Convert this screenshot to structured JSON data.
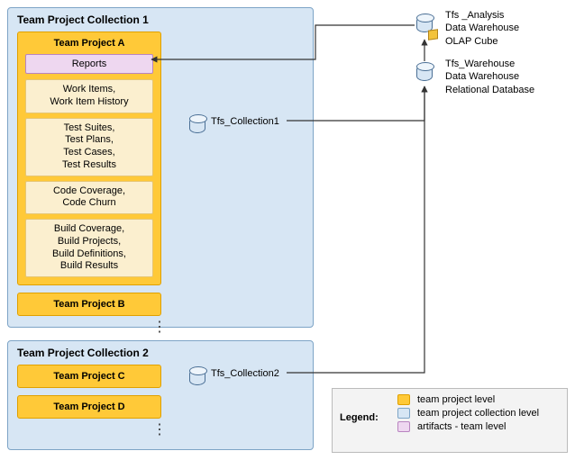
{
  "collections": [
    {
      "title": "Team Project Collection 1",
      "db_label": "Tfs_Collection1",
      "projects": [
        {
          "title": "Team Project A",
          "artifact": "Reports",
          "items": [
            "Work Items,\nWork Item History",
            "Test Suites,\nTest Plans,\nTest Cases,\nTest Results",
            "Code Coverage,\nCode Churn",
            "Build Coverage,\nBuild Projects,\nBuild Definitions,\nBuild Results"
          ]
        },
        {
          "title": "Team Project B"
        }
      ]
    },
    {
      "title": "Team Project Collection 2",
      "db_label": "Tfs_Collection2",
      "projects": [
        {
          "title": "Team Project C"
        },
        {
          "title": "Team Project D"
        }
      ]
    }
  ],
  "warehouse": {
    "analysis": {
      "name": "Tfs _Analysis",
      "line2": "Data Warehouse",
      "line3": "OLAP Cube"
    },
    "relational": {
      "name": "Tfs_Warehouse",
      "line2": "Data Warehouse",
      "line3": "Relational Database"
    }
  },
  "legend": {
    "title": "Legend:",
    "items": [
      {
        "swatch": "orange",
        "label": "team project level"
      },
      {
        "swatch": "blue",
        "label": "team project collection level"
      },
      {
        "swatch": "purple",
        "label": "artifacts - team level"
      }
    ]
  },
  "chart_data": {
    "type": "diagram",
    "description": "TFS data-warehouse architecture: multiple Team Project Collections each contain Team Projects; artifacts (Reports) inside a Team Project are fed by Tfs_Analysis OLAP cube; collection databases (Tfs_Collection1, Tfs_Collection2) feed Tfs_Warehouse relational data warehouse; Tfs_Warehouse feeds Tfs_Analysis.",
    "nodes": [
      {
        "id": "coll1",
        "label": "Team Project Collection 1",
        "level": "collection"
      },
      {
        "id": "projA",
        "label": "Team Project A",
        "level": "project",
        "parent": "coll1"
      },
      {
        "id": "reports",
        "label": "Reports",
        "level": "artifact",
        "parent": "projA"
      },
      {
        "id": "projA_items",
        "label": [
          "Work Items, Work Item History",
          "Test Suites, Test Plans, Test Cases, Test Results",
          "Code Coverage, Code Churn",
          "Build Coverage, Build Projects, Build Definitions, Build Results"
        ],
        "parent": "projA"
      },
      {
        "id": "projB",
        "label": "Team Project B",
        "level": "project",
        "parent": "coll1"
      },
      {
        "id": "db1",
        "label": "Tfs_Collection1",
        "level": "collection-db",
        "parent": "coll1"
      },
      {
        "id": "coll2",
        "label": "Team Project Collection 2",
        "level": "collection"
      },
      {
        "id": "projC",
        "label": "Team Project C",
        "level": "project",
        "parent": "coll2"
      },
      {
        "id": "projD",
        "label": "Team Project D",
        "level": "project",
        "parent": "coll2"
      },
      {
        "id": "db2",
        "label": "Tfs_Collection2",
        "level": "collection-db",
        "parent": "coll2"
      },
      {
        "id": "analysis",
        "label": "Tfs _Analysis Data Warehouse OLAP Cube",
        "level": "warehouse-olap"
      },
      {
        "id": "warehouse",
        "label": "Tfs_Warehouse Data Warehouse Relational Database",
        "level": "warehouse-relational"
      }
    ],
    "edges": [
      {
        "from": "analysis",
        "to": "reports"
      },
      {
        "from": "warehouse",
        "to": "analysis"
      },
      {
        "from": "db1",
        "to": "warehouse"
      },
      {
        "from": "db2",
        "to": "warehouse"
      }
    ]
  }
}
